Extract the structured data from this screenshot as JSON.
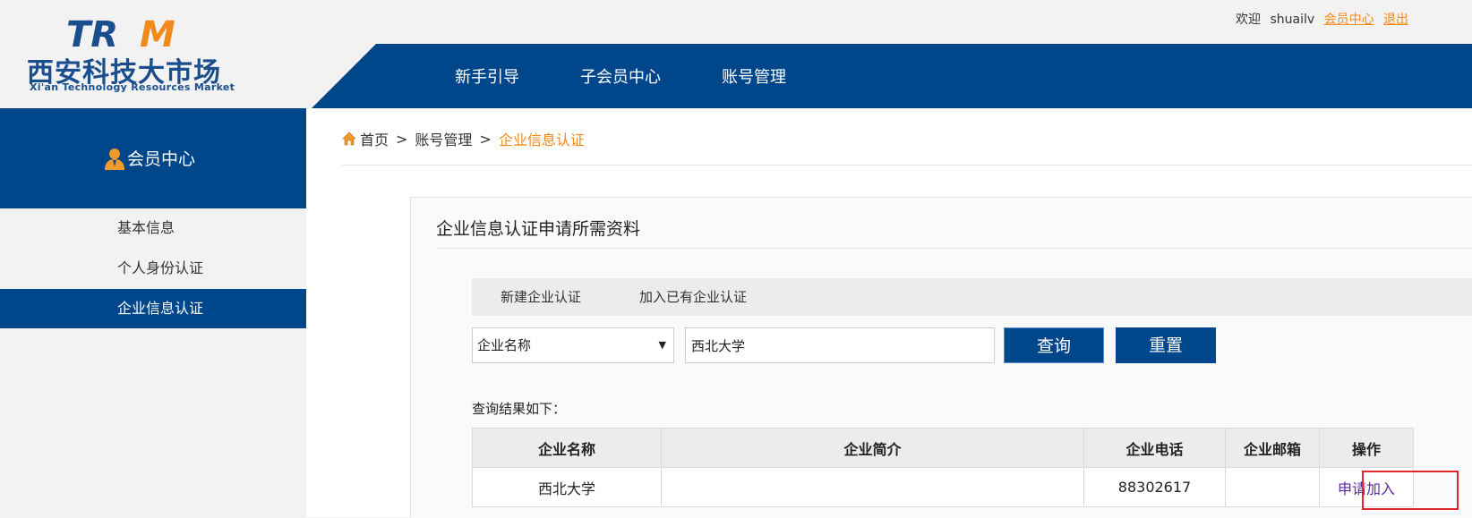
{
  "logo": {
    "mark": "TRM",
    "name_cn": "西安科技大市场",
    "name_en": "Xi'an Technology Resources Market"
  },
  "userbar": {
    "welcome": "欢迎",
    "username": "shuailv",
    "member_center": "会员中心",
    "logout": "退出"
  },
  "nav": {
    "items": [
      {
        "label": "新手引导"
      },
      {
        "label": "子会员中心"
      },
      {
        "label": "账号管理"
      }
    ]
  },
  "sidebar": {
    "title": "会员中心",
    "items": [
      {
        "label": "基本信息",
        "active": false
      },
      {
        "label": "个人身份认证",
        "active": false
      },
      {
        "label": "企业信息认证",
        "active": true
      }
    ]
  },
  "breadcrumb": {
    "home": "首页",
    "separator": ">",
    "parent": "账号管理",
    "current": "企业信息认证"
  },
  "panel": {
    "title": "企业信息认证申请所需资料",
    "tabs": [
      {
        "label": "新建企业认证"
      },
      {
        "label": "加入已有企业认证"
      }
    ],
    "search": {
      "field_select": "企业名称",
      "query_value": "西北大学",
      "query_button": "查询",
      "reset_button": "重置"
    },
    "result_label": "查询结果如下：",
    "table": {
      "headers": [
        "企业名称",
        "企业简介",
        "企业电话",
        "企业邮箱",
        "操作"
      ],
      "rows": [
        {
          "name": "西北大学",
          "intro": "",
          "phone": "88302617",
          "email": "",
          "action": "申请加入"
        }
      ]
    }
  },
  "colors": {
    "primary_blue": "#00468b",
    "accent_orange": "#f08a1c",
    "highlight_red": "#e0282f"
  }
}
